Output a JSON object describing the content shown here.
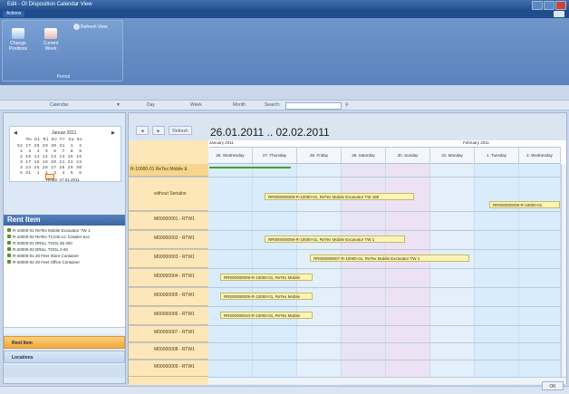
{
  "window": {
    "title": "Edit - OI Disposition Calendar View",
    "menu_label": "Actions"
  },
  "ribbon": {
    "group_label": "Period",
    "buttons": [
      {
        "label": "Change Positions"
      },
      {
        "label": "Current Week"
      }
    ],
    "refresh_view": "Refresh View"
  },
  "toolbar": {
    "calendar_tab": "Calendar",
    "day": "Day",
    "week": "Week",
    "month": "Month",
    "search_label": "Search:",
    "search_value": ""
  },
  "mini_calendar": {
    "month_label": "Januar 2011",
    "weekday_row": "Mo Di Mi Do Fr Sa So",
    "rows": [
      "52 27 28 29 30 31  1  2",
      " 1  3  4  5  6  7  8  9",
      " 2 10 11 12 13 14 15 16",
      " 3 17 18 19 20 21 22 23",
      " 4 24 25 26 27 28 29 30",
      " 5 31  1  2  3  4  5  6"
    ],
    "today_label": "Heute: 27.01.2011"
  },
  "rent_items": {
    "header": "Rent Item",
    "items": [
      "R-10000-01 ReTex Mobile Excavator TW 1",
      "R-10000-02 ReTex TC240 LC Crawler Exc",
      "R-20000-01 DRILL TOOL 55 400",
      "R-20000-02 DRILL TOOL 2-60",
      "R-40000-01 20 Feet Store Container",
      "R-40000-02 20 Feet Office Container"
    ]
  },
  "nav_buttons": {
    "rent_items": "Rent Item",
    "locations": "Locations"
  },
  "scheduler": {
    "back_label": "◄",
    "forward_label": "►",
    "refresh_label": "Refresh",
    "date_range": "26.01.2011 .. 02.02.2011",
    "month_january": "January 2011",
    "month_february": "February 2011",
    "days": [
      "26. Wednesday",
      "27. Thursday",
      "28. Friday",
      "29. Saturday",
      "30. Sunday",
      "31. Monday",
      "1. Tuesday",
      "2. Wednesday"
    ],
    "resources": [
      "R-10000-01 ReTex Mobile E",
      "without Serialno",
      "M00000001 - RTW1",
      "M00000002 - RTW1",
      "M00000003 - RTW1",
      "M00000004 - RTW1",
      "M00000005 - RTW1",
      "M00000006 - RTW1",
      "M00000007 - RTW1",
      "M00000008 - RTW1",
      "M00000009 - RTW1"
    ],
    "appointments": [
      "RR000000008-R-10000-01, ReTex Mobile Excavator TW 180",
      "RR000000008-R-10000-01",
      "RR000000006-R-10000-01, ReTex Mobile Excavator TW 1",
      "RR000000007-R-10000-01, ReTex Mobile Excavator TW 1",
      "RR000000008-R-10000-01, ReTex Mobile",
      "RR000000009-R-10000-01, ReTex Mobile",
      "RR000000010-R-10000-01, ReTex Mobile"
    ]
  },
  "status": {
    "ok": "OK"
  },
  "colors": {
    "ribbon": "#5a83bd",
    "resource_bg": "#fde7b8",
    "appointment_bg": "#f9f4b7",
    "accent": "#f3a73c"
  }
}
